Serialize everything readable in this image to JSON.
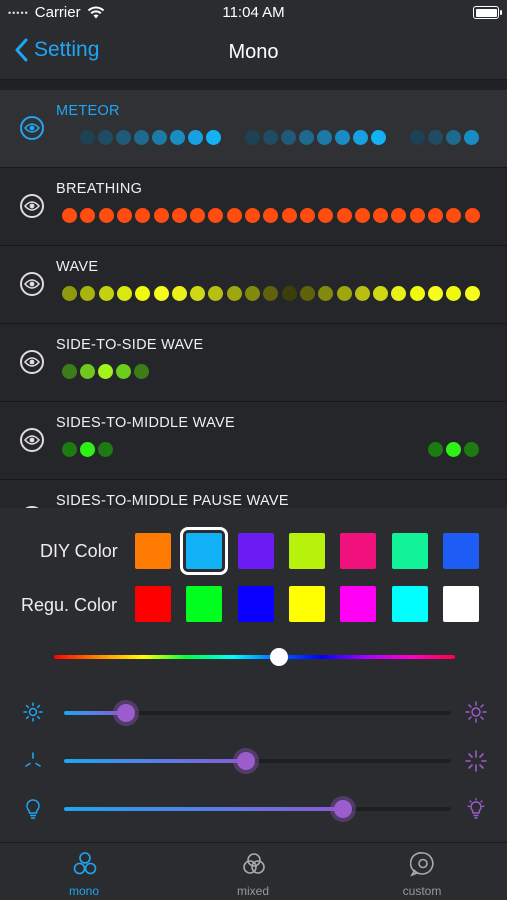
{
  "status": {
    "carrier": "Carrier",
    "time": "11:04 AM"
  },
  "nav": {
    "back_label": "Setting",
    "title": "Mono"
  },
  "effects": [
    {
      "name": "METEOR",
      "selected": true
    },
    {
      "name": "BREATHING",
      "selected": false
    },
    {
      "name": "WAVE",
      "selected": false
    },
    {
      "name": "SIDE-TO-SIDE WAVE",
      "selected": false
    },
    {
      "name": "SIDES-TO-MIDDLE WAVE",
      "selected": false
    },
    {
      "name": "SIDES-TO-MIDDLE PAUSE WAVE",
      "selected": false
    }
  ],
  "panel": {
    "diy_label": "DIY Color",
    "regu_label": "Regu. Color",
    "diy_colors": [
      "#ff7a00",
      "#12b0f4",
      "#6a1cf2",
      "#b6f20c",
      "#f2127d",
      "#12f299",
      "#1d5cf5"
    ],
    "diy_selected_index": 1,
    "regu_colors": [
      "#ff0000",
      "#00ff1e",
      "#0a00ff",
      "#ffff00",
      "#ff00f5",
      "#00ffff",
      "#ffffff"
    ],
    "hue_position": 0.56,
    "brightness": 0.16,
    "speed": 0.47,
    "intensity": 0.72
  },
  "tabs": [
    {
      "label": "mono",
      "icon": "mono-circles-icon",
      "active": true
    },
    {
      "label": "mixed",
      "icon": "mixed-circles-icon",
      "active": false
    },
    {
      "label": "custom",
      "icon": "custom-chat-icon",
      "active": false
    }
  ],
  "accent": "#1ea6f4"
}
